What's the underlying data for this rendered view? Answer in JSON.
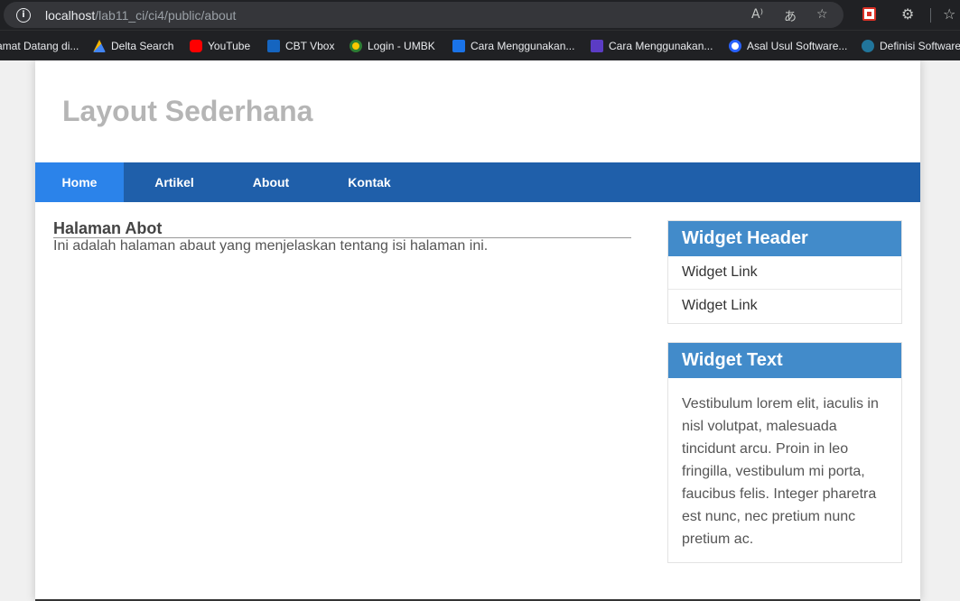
{
  "browser": {
    "url_host": "localhost",
    "url_path": "/lab11_ci/ci4/public/about",
    "bookmarks": [
      {
        "label": "amat Datang di...",
        "color": "#3c8d2f"
      },
      {
        "label": "Delta Search",
        "color": "#f4b400"
      },
      {
        "label": "YouTube",
        "color": "#ff0000"
      },
      {
        "label": "CBT Vbox",
        "color": "#1565c0"
      },
      {
        "label": "Login - UMBK",
        "color": "#4caf50"
      },
      {
        "label": "Cara Menggunakan...",
        "color": "#1a73e8"
      },
      {
        "label": "Cara Menggunakan...",
        "color": "#5b3cc4"
      },
      {
        "label": "Asal Usul Software...",
        "color": "#2962ff"
      },
      {
        "label": "Definisi Software",
        "color": "#21759b"
      }
    ]
  },
  "site": {
    "title": "Layout Sederhana",
    "nav": [
      "Home",
      "Artikel",
      "About",
      "Kontak"
    ],
    "active_nav": "Home"
  },
  "main": {
    "heading": "Halaman Abot",
    "text": "Ini adalah halaman abaut yang menjelaskan tentang isi halaman ini."
  },
  "sidebar": {
    "widget1": {
      "header": "Widget Header",
      "links": [
        "Widget Link",
        "Widget Link"
      ]
    },
    "widget2": {
      "header": "Widget Text",
      "body": "Vestibulum lorem elit, iaculis in nisl volutpat, malesuada tincidunt arcu. Proin in leo fringilla, vestibulum mi porta, faucibus felis. Integer pharetra est nunc, nec pretium nunc pretium ac."
    }
  },
  "colors": {
    "nav_bg": "#1f5faa",
    "nav_active": "#2b83ea",
    "widget_header": "#428bca",
    "title": "#b5b5b5"
  }
}
